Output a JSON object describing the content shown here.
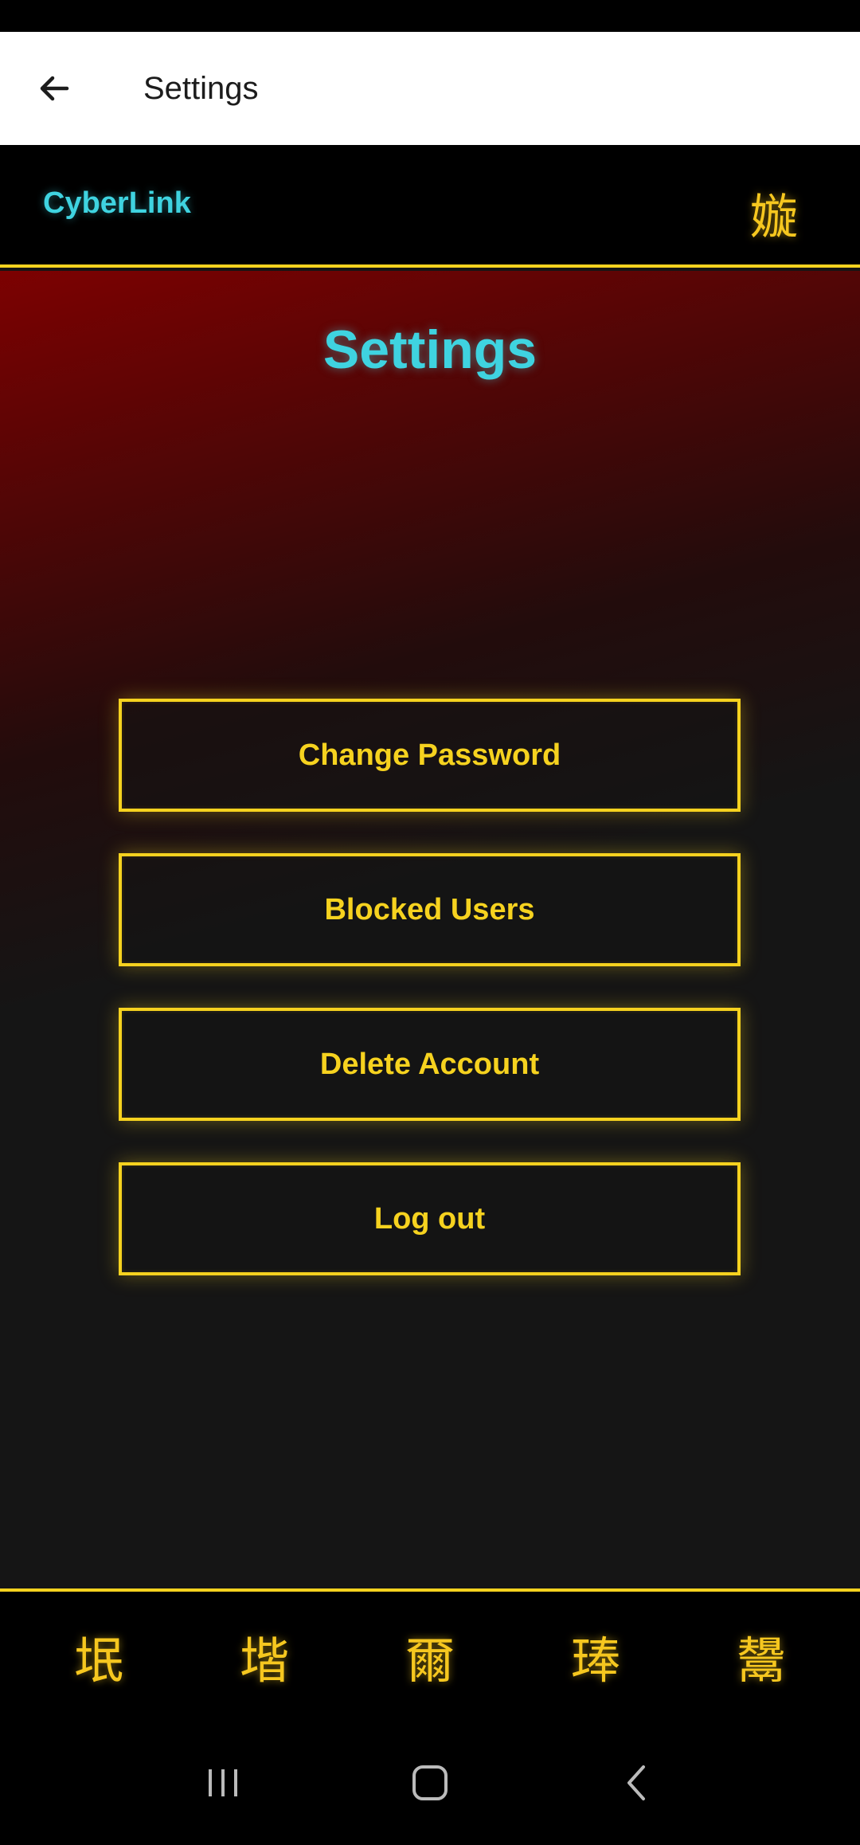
{
  "appbar": {
    "title": "Settings",
    "back_icon": "arrow-left-icon"
  },
  "header": {
    "brand": "CyberLink",
    "icon_glyph": "嫙"
  },
  "main": {
    "title": "Settings",
    "buttons": [
      {
        "label": "Change Password"
      },
      {
        "label": "Blocked Users"
      },
      {
        "label": "Delete Account"
      },
      {
        "label": "Log out"
      }
    ]
  },
  "bottom_nav": {
    "items": [
      {
        "glyph": "垊"
      },
      {
        "glyph": "堦"
      },
      {
        "glyph": "爾"
      },
      {
        "glyph": "琫"
      },
      {
        "glyph": "鬹"
      }
    ]
  },
  "system_nav": {
    "items": [
      "recent-apps-icon",
      "home-icon",
      "back-icon"
    ]
  },
  "colors": {
    "accent_yellow": "#f6d21f",
    "accent_cyan": "#3fd3e0",
    "background": "#151515",
    "gradient_red": "#820000"
  }
}
